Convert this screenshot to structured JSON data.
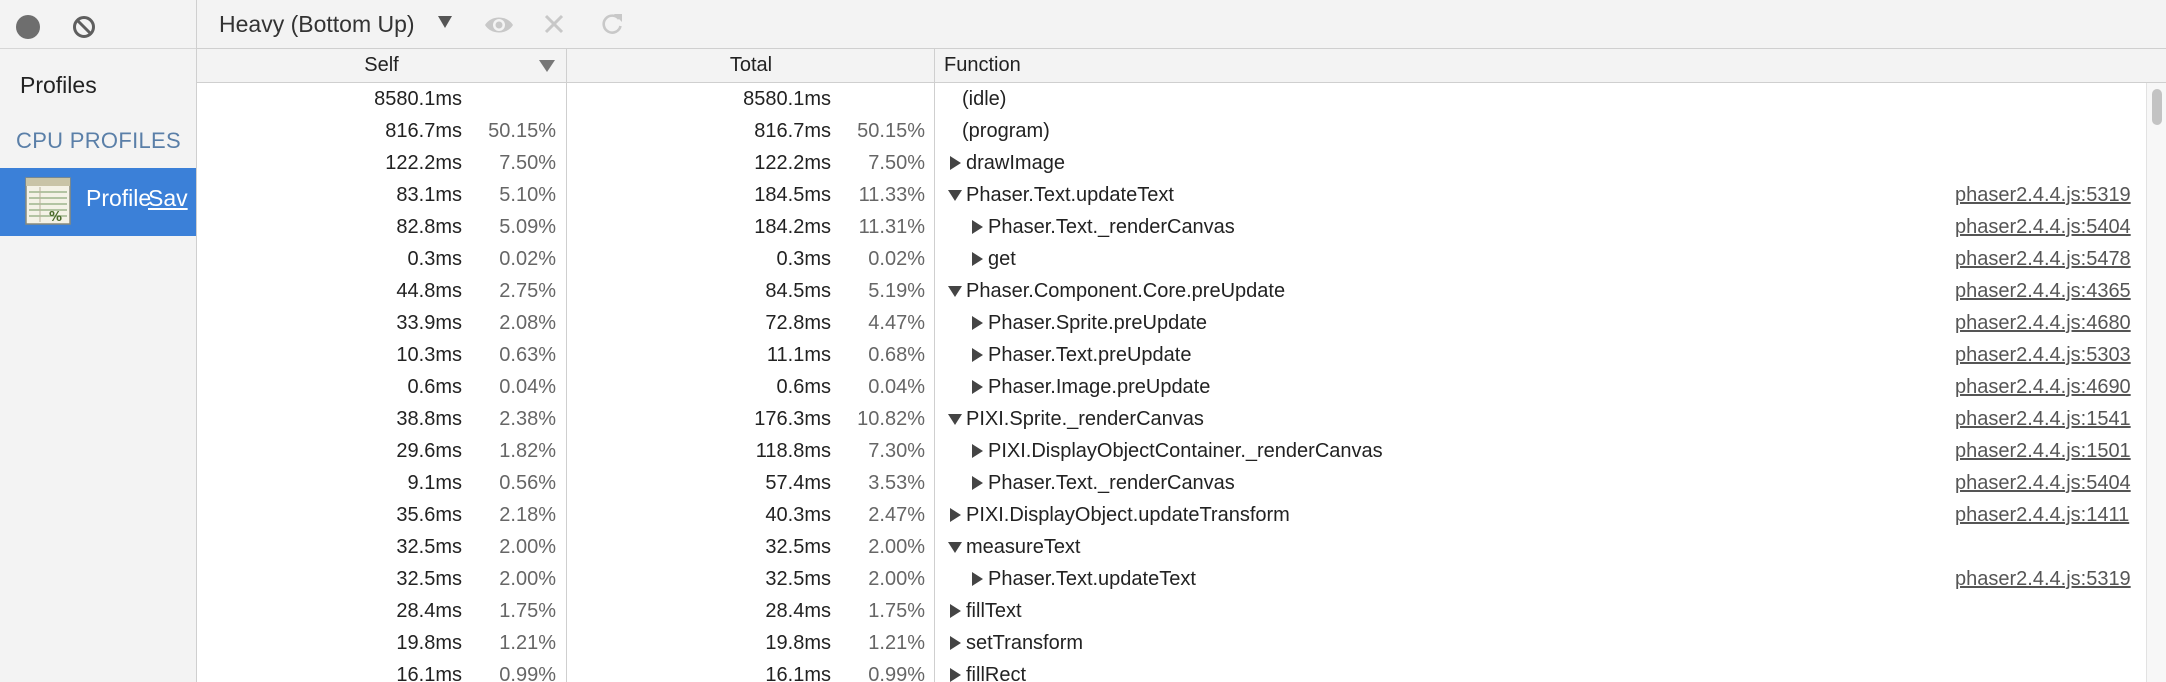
{
  "sidebar": {
    "title": "Profiles",
    "section": "CPU PROFILES",
    "item": {
      "label": "Profile",
      "sublabel": "Sav"
    }
  },
  "toolbar": {
    "view_mode": "Heavy (Bottom Up)"
  },
  "columns": {
    "self": "Self",
    "total": "Total",
    "function": "Function"
  },
  "colors": {
    "accent": "#3b80d8",
    "section": "#5a7fa8"
  },
  "rows": [
    {
      "self_ms": "8580.1ms",
      "self_pct": "",
      "total_ms": "8580.1ms",
      "total_pct": "",
      "function": "(idle)",
      "expand": "none",
      "depth": 0,
      "url": ""
    },
    {
      "self_ms": "816.7ms",
      "self_pct": "50.15%",
      "total_ms": "816.7ms",
      "total_pct": "50.15%",
      "function": "(program)",
      "expand": "none",
      "depth": 0,
      "url": ""
    },
    {
      "self_ms": "122.2ms",
      "self_pct": "7.50%",
      "total_ms": "122.2ms",
      "total_pct": "7.50%",
      "function": "drawImage",
      "expand": "collapsed",
      "depth": 0,
      "url": ""
    },
    {
      "self_ms": "83.1ms",
      "self_pct": "5.10%",
      "total_ms": "184.5ms",
      "total_pct": "11.33%",
      "function": "Phaser.Text.updateText",
      "expand": "expanded",
      "depth": 0,
      "url": "phaser2.4.4.js:5319"
    },
    {
      "self_ms": "82.8ms",
      "self_pct": "5.09%",
      "total_ms": "184.2ms",
      "total_pct": "11.31%",
      "function": "Phaser.Text._renderCanvas",
      "expand": "collapsed",
      "depth": 1,
      "url": "phaser2.4.4.js:5404"
    },
    {
      "self_ms": "0.3ms",
      "self_pct": "0.02%",
      "total_ms": "0.3ms",
      "total_pct": "0.02%",
      "function": "get",
      "expand": "collapsed",
      "depth": 1,
      "url": "phaser2.4.4.js:5478"
    },
    {
      "self_ms": "44.8ms",
      "self_pct": "2.75%",
      "total_ms": "84.5ms",
      "total_pct": "5.19%",
      "function": "Phaser.Component.Core.preUpdate",
      "expand": "expanded",
      "depth": 0,
      "url": "phaser2.4.4.js:4365"
    },
    {
      "self_ms": "33.9ms",
      "self_pct": "2.08%",
      "total_ms": "72.8ms",
      "total_pct": "4.47%",
      "function": "Phaser.Sprite.preUpdate",
      "expand": "collapsed",
      "depth": 1,
      "url": "phaser2.4.4.js:4680"
    },
    {
      "self_ms": "10.3ms",
      "self_pct": "0.63%",
      "total_ms": "11.1ms",
      "total_pct": "0.68%",
      "function": "Phaser.Text.preUpdate",
      "expand": "collapsed",
      "depth": 1,
      "url": "phaser2.4.4.js:5303"
    },
    {
      "self_ms": "0.6ms",
      "self_pct": "0.04%",
      "total_ms": "0.6ms",
      "total_pct": "0.04%",
      "function": "Phaser.Image.preUpdate",
      "expand": "collapsed",
      "depth": 1,
      "url": "phaser2.4.4.js:4690"
    },
    {
      "self_ms": "38.8ms",
      "self_pct": "2.38%",
      "total_ms": "176.3ms",
      "total_pct": "10.82%",
      "function": "PIXI.Sprite._renderCanvas",
      "expand": "expanded",
      "depth": 0,
      "url": "phaser2.4.4.js:1541"
    },
    {
      "self_ms": "29.6ms",
      "self_pct": "1.82%",
      "total_ms": "118.8ms",
      "total_pct": "7.30%",
      "function": "PIXI.DisplayObjectContainer._renderCanvas",
      "expand": "collapsed",
      "depth": 1,
      "url": "phaser2.4.4.js:1501"
    },
    {
      "self_ms": "9.1ms",
      "self_pct": "0.56%",
      "total_ms": "57.4ms",
      "total_pct": "3.53%",
      "function": "Phaser.Text._renderCanvas",
      "expand": "collapsed",
      "depth": 1,
      "url": "phaser2.4.4.js:5404"
    },
    {
      "self_ms": "35.6ms",
      "self_pct": "2.18%",
      "total_ms": "40.3ms",
      "total_pct": "2.47%",
      "function": "PIXI.DisplayObject.updateTransform",
      "expand": "collapsed",
      "depth": 0,
      "url": "phaser2.4.4.js:1411"
    },
    {
      "self_ms": "32.5ms",
      "self_pct": "2.00%",
      "total_ms": "32.5ms",
      "total_pct": "2.00%",
      "function": "measureText",
      "expand": "expanded",
      "depth": 0,
      "url": ""
    },
    {
      "self_ms": "32.5ms",
      "self_pct": "2.00%",
      "total_ms": "32.5ms",
      "total_pct": "2.00%",
      "function": "Phaser.Text.updateText",
      "expand": "collapsed",
      "depth": 1,
      "url": "phaser2.4.4.js:5319"
    },
    {
      "self_ms": "28.4ms",
      "self_pct": "1.75%",
      "total_ms": "28.4ms",
      "total_pct": "1.75%",
      "function": "fillText",
      "expand": "collapsed",
      "depth": 0,
      "url": ""
    },
    {
      "self_ms": "19.8ms",
      "self_pct": "1.21%",
      "total_ms": "19.8ms",
      "total_pct": "1.21%",
      "function": "setTransform",
      "expand": "collapsed",
      "depth": 0,
      "url": ""
    },
    {
      "self_ms": "16.1ms",
      "self_pct": "0.99%",
      "total_ms": "16.1ms",
      "total_pct": "0.99%",
      "function": "fillRect",
      "expand": "collapsed",
      "depth": 0,
      "url": ""
    }
  ]
}
